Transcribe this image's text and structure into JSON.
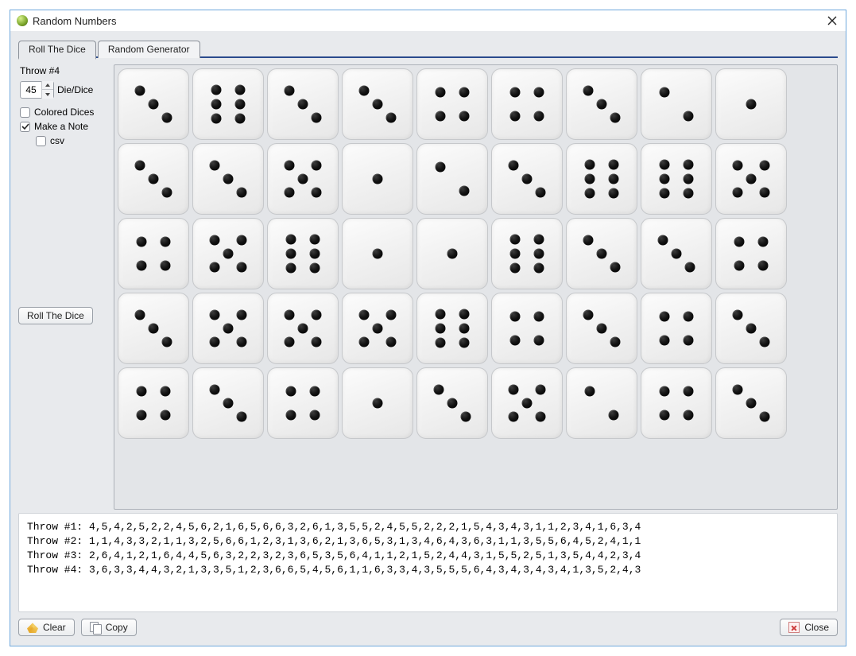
{
  "window": {
    "title": "Random Numbers"
  },
  "tabs": [
    {
      "label": "Roll The Dice",
      "active": true
    },
    {
      "label": "Random Generator",
      "active": false
    }
  ],
  "sidebar": {
    "throw_label": "Throw #4",
    "dice_count": "45",
    "dice_label": "Die/Dice",
    "colored_label": "Colored Dices",
    "colored_checked": false,
    "note_label": "Make a Note",
    "note_checked": true,
    "csv_label": "csv",
    "csv_checked": false,
    "roll_button": "Roll The Dice"
  },
  "dice": [
    [
      3,
      6,
      3,
      3,
      4,
      4,
      3,
      2,
      1
    ],
    [
      3,
      3,
      5,
      1,
      2,
      3,
      6,
      6,
      5
    ],
    [
      4,
      5,
      6,
      1,
      1,
      6,
      3,
      3,
      4
    ],
    [
      3,
      5,
      5,
      5,
      6,
      4,
      3,
      4,
      3
    ],
    [
      4,
      3,
      4,
      1,
      3,
      5,
      2,
      4,
      3
    ]
  ],
  "log": [
    "Throw #1: 4,5,4,2,5,2,2,4,5,6,2,1,6,5,6,6,3,2,6,1,3,5,5,2,4,5,5,2,2,2,1,5,4,3,4,3,1,1,2,3,4,1,6,3,4",
    "Throw #2: 1,1,4,3,3,2,1,1,3,2,5,6,6,1,2,3,1,3,6,2,1,3,6,5,3,1,3,4,6,4,3,6,3,1,1,3,5,5,6,4,5,2,4,1,1",
    "Throw #3: 2,6,4,1,2,1,6,4,4,5,6,3,2,2,3,2,3,6,5,3,5,6,4,1,1,2,1,5,2,4,4,3,1,5,5,2,5,1,3,5,4,4,2,3,4",
    "Throw #4: 3,6,3,3,4,4,3,2,1,3,3,5,1,2,3,6,6,5,4,5,6,1,1,6,3,3,4,3,5,5,5,6,4,3,4,3,4,3,4,1,3,5,2,4,3"
  ],
  "footer": {
    "clear": "Clear",
    "copy": "Copy",
    "close": "Close"
  }
}
